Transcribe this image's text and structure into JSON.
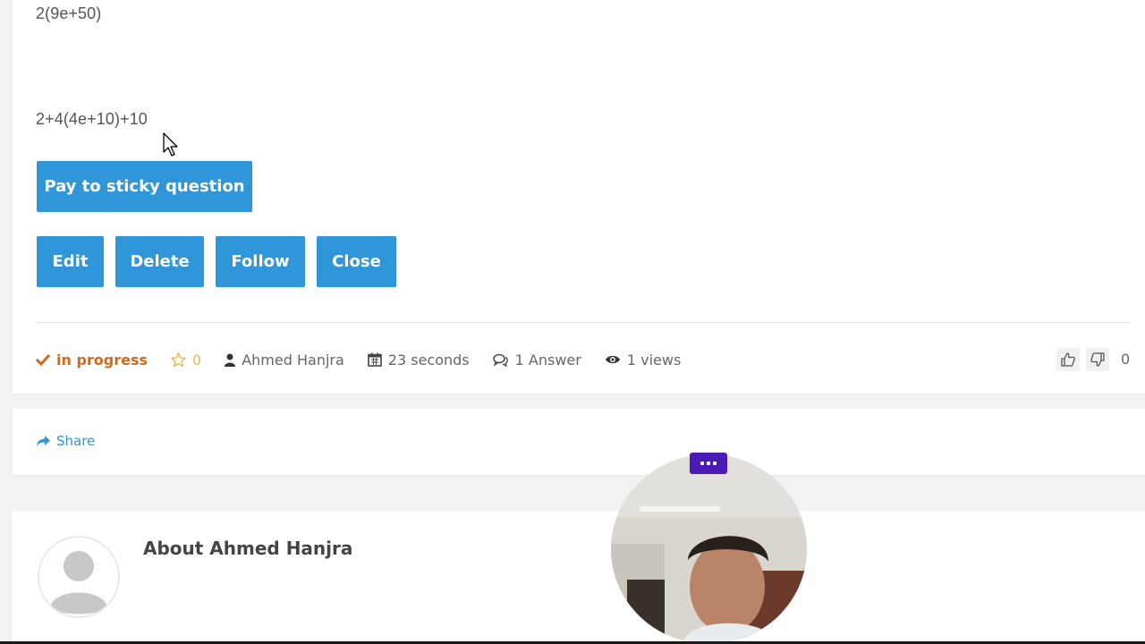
{
  "question": {
    "math_lines": [
      "2(9e+50)",
      "2+4(4e+10)+10"
    ],
    "sticky_button": "Pay to sticky question",
    "actions": [
      "Edit",
      "Delete",
      "Follow",
      "Close"
    ]
  },
  "meta": {
    "status": "in progress",
    "favorites": "0",
    "author": "Ahmed Hanjra",
    "time": "23 seconds",
    "answers": "1 Answer",
    "views": "1 views",
    "vote_count": "0"
  },
  "share": {
    "label": "Share"
  },
  "about": {
    "title": "About Ahmed Hanjra"
  },
  "colors": {
    "button": "#2f97d9",
    "status": "#d2691e",
    "star": "#e8b94b",
    "webcam_menu": "#4b1ab5"
  },
  "icons": [
    "check-icon",
    "star-icon",
    "user-icon",
    "calendar-icon",
    "comments-icon",
    "eye-icon",
    "thumbs-up-icon",
    "thumbs-down-icon",
    "share-icon",
    "more-icon"
  ]
}
